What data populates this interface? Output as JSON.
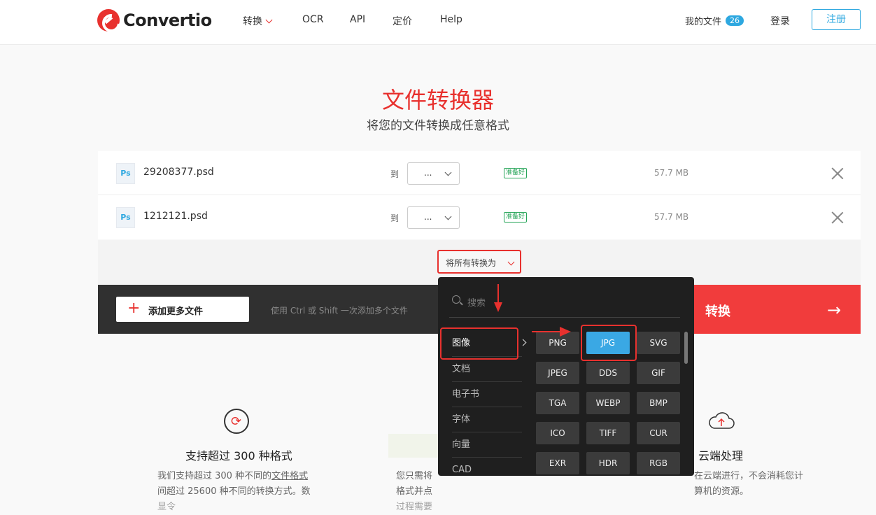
{
  "header": {
    "logo": "Convertio",
    "nav": {
      "convert": "转换",
      "ocr": "OCR",
      "api": "API",
      "pricing": "定价",
      "help": "Help"
    },
    "my_files": "我的文件",
    "my_files_count": "26",
    "login": "登录",
    "signup": "注册"
  },
  "hero": {
    "title": "文件转换器",
    "subtitle": "将您的文件转换成任意格式"
  },
  "files": [
    {
      "icon": "Ps",
      "name": "29208377.psd",
      "to": "到",
      "select": "...",
      "status": "准备好",
      "size": "57.7 MB"
    },
    {
      "icon": "Ps",
      "name": "1212121.psd",
      "to": "到",
      "select": "...",
      "status": "准备好",
      "size": "57.7 MB"
    }
  ],
  "convert_all": "将所有转换为",
  "toolbar": {
    "add_label": "添加更多文件",
    "hint": "使用 Ctrl 或 Shift 一次添加多个文件",
    "convert_label": "转换",
    "arrow": "→"
  },
  "dropdown": {
    "search_placeholder": "搜索",
    "categories": [
      "图像",
      "文档",
      "电子书",
      "字体",
      "向量",
      "CAD"
    ],
    "formats": [
      "PNG",
      "JPG",
      "SVG",
      "JPEG",
      "DDS",
      "GIF",
      "TGA",
      "WEBP",
      "BMP",
      "ICO",
      "TIFF",
      "CUR",
      "EXR",
      "HDR",
      "RGB"
    ],
    "selected_format": "JPG"
  },
  "features": [
    {
      "title": "支持超过 300 种格式",
      "lines": [
        "我们支持超过 300 种不同的",
        "文件格式",
        "间超过 25600 种不同的转换方式。数",
        "显令"
      ]
    },
    {
      "lines": [
        "您只需将",
        "格式并点",
        "过程需要"
      ]
    },
    {
      "title": "云端处理",
      "lines": [
        "在云端进行，不会消耗您计",
        "算机的资源。"
      ]
    }
  ],
  "colors": {
    "brand": "#e8312e",
    "accent": "#2ea8e0",
    "convert": "#f13c3c",
    "selected": "#3aa8e4"
  }
}
